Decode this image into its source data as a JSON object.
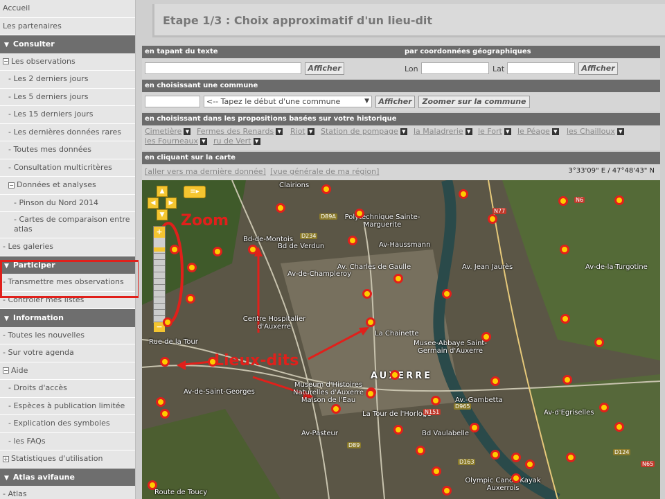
{
  "sidebar": {
    "items": [
      {
        "label": "Accueil",
        "type": "item"
      },
      {
        "label": "Les partenaires",
        "type": "item"
      },
      {
        "label": "Consulter",
        "type": "head"
      },
      {
        "label": "Les observations",
        "type": "item",
        "prefix": "−"
      },
      {
        "label": "- Les 2 derniers jours",
        "type": "item",
        "indent": 1
      },
      {
        "label": "- Les 5 derniers jours",
        "type": "item",
        "indent": 1
      },
      {
        "label": "- Les 15 derniers jours",
        "type": "item",
        "indent": 1
      },
      {
        "label": "- Les dernières données rares",
        "type": "item",
        "indent": 1
      },
      {
        "label": "- Toutes mes données",
        "type": "item",
        "indent": 1
      },
      {
        "label": "- Consultation multicritères",
        "type": "item",
        "indent": 1
      },
      {
        "label": "Données et analyses",
        "type": "item",
        "prefix": "−",
        "indent": 1
      },
      {
        "label": "- Pinson du Nord 2014",
        "type": "item",
        "indent": 2
      },
      {
        "label": "- Cartes de comparaison entre atlas",
        "type": "item",
        "indent": 2,
        "double": true
      },
      {
        "label": "- Les galeries",
        "type": "item"
      },
      {
        "label": "Participer",
        "type": "head"
      },
      {
        "label": "- Transmettre mes observations",
        "type": "item"
      },
      {
        "label": "- Contrôler mes listes",
        "type": "item"
      },
      {
        "label": "Information",
        "type": "head"
      },
      {
        "label": "- Toutes les nouvelles",
        "type": "item"
      },
      {
        "label": "- Sur votre agenda",
        "type": "item"
      },
      {
        "label": "Aide",
        "type": "item",
        "prefix": "−"
      },
      {
        "label": "- Droits d'accès",
        "type": "item",
        "indent": 1
      },
      {
        "label": "- Espèces à publication limitée",
        "type": "item",
        "indent": 1
      },
      {
        "label": "- Explication des symboles",
        "type": "item",
        "indent": 1
      },
      {
        "label": "- les FAQs",
        "type": "item",
        "indent": 1
      },
      {
        "label": "Statistiques d'utilisation",
        "type": "item",
        "prefix": "+"
      },
      {
        "label": "Atlas avifaune",
        "type": "head"
      },
      {
        "label": "- Atlas",
        "type": "item"
      }
    ]
  },
  "step_title": "Etape 1/3 : Choix approximatif d'un lieu-dit",
  "text_search": {
    "title": "en tapant du texte",
    "value": "",
    "button": "Afficher"
  },
  "coord_search": {
    "title": "par coordonnées géographiques",
    "lon_label": "Lon",
    "lat_label": "Lat",
    "lon_value": "",
    "lat_value": "",
    "button": "Afficher"
  },
  "commune": {
    "title": "en choisissant une commune",
    "input_value": "",
    "select_value": "<-- Tapez le début d'une commune",
    "button": "Afficher",
    "zoom_button": "Zoomer sur la commune"
  },
  "history": {
    "title": "en choisissant dans les propositions basées sur votre historique",
    "items": [
      "Cimetière",
      "Fermes des Renards",
      "Riot",
      "Station de pompage",
      "la Maladrerie",
      "le Fort",
      "le Péage",
      "les Chailloux",
      "les Fourneaux",
      "ru de Vert"
    ]
  },
  "map_section": {
    "title": "en cliquant sur la carte",
    "link_last": "[aller vers ma dernière donnée]",
    "link_region": "[vue générale de ma région]",
    "coords": "3°33'09\" E / 47°48'43\" N"
  },
  "annotations": {
    "zoom": "Zoom",
    "lieux": "Lieux-dits"
  },
  "map_labels": [
    "AUXERRE",
    "Polytechnique Sainte-Marguerite",
    "Musee-Abbaye Saint-Germain d'Auxerre",
    "Centre Hospitalier d'Auxerre",
    "Museum d'Histoires Naturelles d'Auxerre Maison de l'Eau",
    "La Tour de l'Horloge",
    "Olympic Canoe Kayak Auxerrois",
    "La Chainette",
    "Clairions",
    "Av.-Gambetta",
    "Route de Toucy",
    "Rue de la Tour",
    "Av-Pasteur",
    "Av-de-Saint-Georges",
    "Bd de Verdun",
    "Bd Vaulabelle",
    "Av-Haussmann",
    "Av. Charles de Gaulle",
    "Av-de-Champleroy",
    "Av-d'Egriselles",
    "Av-de-la-Turgotine",
    "Bd-de-Montois",
    "Av. Jean Jaurès",
    "D89A",
    "D234",
    "N77",
    "N6",
    "D124",
    "D965",
    "D163",
    "D89",
    "N151",
    "N65"
  ]
}
